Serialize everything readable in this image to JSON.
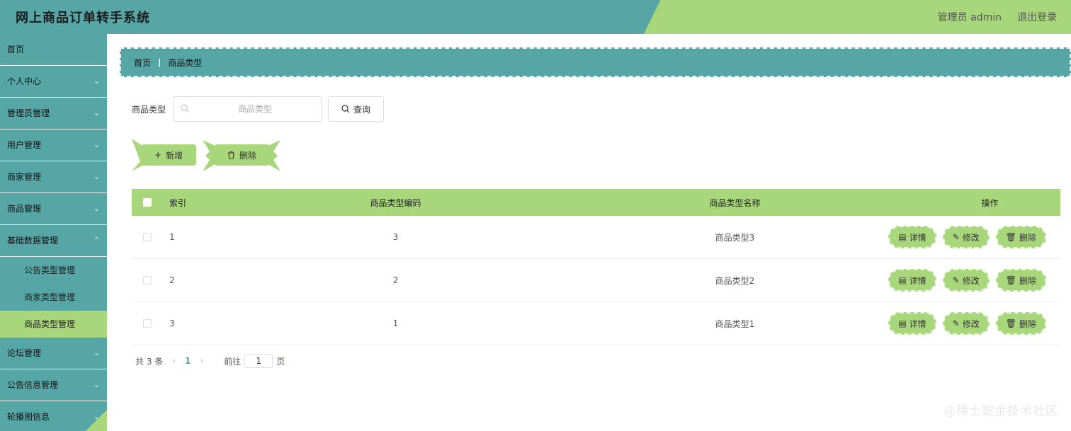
{
  "header": {
    "title": "网上商品订单转手系统",
    "user_label": "管理员 admin",
    "logout_label": "退出登录"
  },
  "sidebar": {
    "items": [
      {
        "label": "首页"
      },
      {
        "label": "个人中心"
      },
      {
        "label": "管理员管理"
      },
      {
        "label": "用户管理"
      },
      {
        "label": "商家管理"
      },
      {
        "label": "商品管理"
      },
      {
        "label": "基础数据管理"
      },
      {
        "label": "论坛管理"
      },
      {
        "label": "公告信息管理"
      },
      {
        "label": "轮播图信息"
      }
    ],
    "subitems": [
      {
        "label": "公告类型管理"
      },
      {
        "label": "商家类型管理"
      },
      {
        "label": "商品类型管理"
      }
    ]
  },
  "breadcrumb": {
    "home": "首页",
    "current": "商品类型"
  },
  "search": {
    "label": "商品类型",
    "placeholder": "商品类型",
    "value": "",
    "query_button": "查询"
  },
  "actions": {
    "add_label": "新增",
    "delete_label": "删除"
  },
  "table": {
    "headers": {
      "index": "索引",
      "code": "商品类型编码",
      "name": "商品类型名称",
      "ops": "操作"
    },
    "rows": [
      {
        "index": "1",
        "code": "3",
        "name": "商品类型3"
      },
      {
        "index": "2",
        "code": "2",
        "name": "商品类型2"
      },
      {
        "index": "3",
        "code": "1",
        "name": "商品类型1"
      }
    ],
    "row_actions": {
      "detail": "详情",
      "edit": "修改",
      "delete": "删除"
    }
  },
  "pagination": {
    "total_text": "共 3 条",
    "current_page": "1",
    "goto_label": "前往",
    "goto_value": "1",
    "page_suffix": "页"
  },
  "watermark": "@稀土掘金技术社区",
  "colors": {
    "teal": "#57a6a6",
    "green": "#a8d67a"
  }
}
